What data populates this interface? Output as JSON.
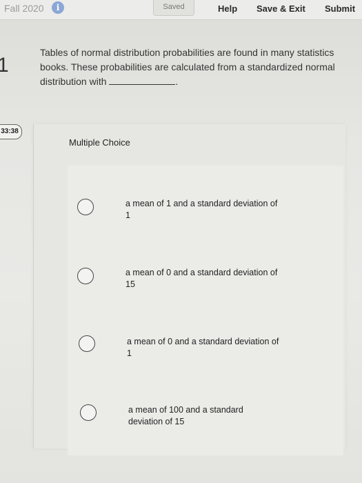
{
  "header": {
    "course": "Fall 2020",
    "info_icon": "i",
    "status": "Saved",
    "help_label": "Help",
    "save_exit_label": "Save & Exit",
    "submit_label": "Submit"
  },
  "question": {
    "number": "1",
    "text": "Tables of normal distribution probabilities are found in many statistics books. These probabilities are calculated from a standardized normal distribution with",
    "end_punct": "."
  },
  "timer": "33:38",
  "multiple_choice": {
    "heading": "Multiple Choice",
    "options": [
      {
        "text": "a mean of 1 and a standard deviation of 1"
      },
      {
        "text": "a mean of 0 and a standard deviation of 15"
      },
      {
        "text": "a mean of 0 and a standard deviation of 1"
      },
      {
        "text": "a mean of 100 and a standard deviation of 15"
      }
    ]
  },
  "icons": {
    "info": "info-icon",
    "radio": "radio-button-icon"
  }
}
